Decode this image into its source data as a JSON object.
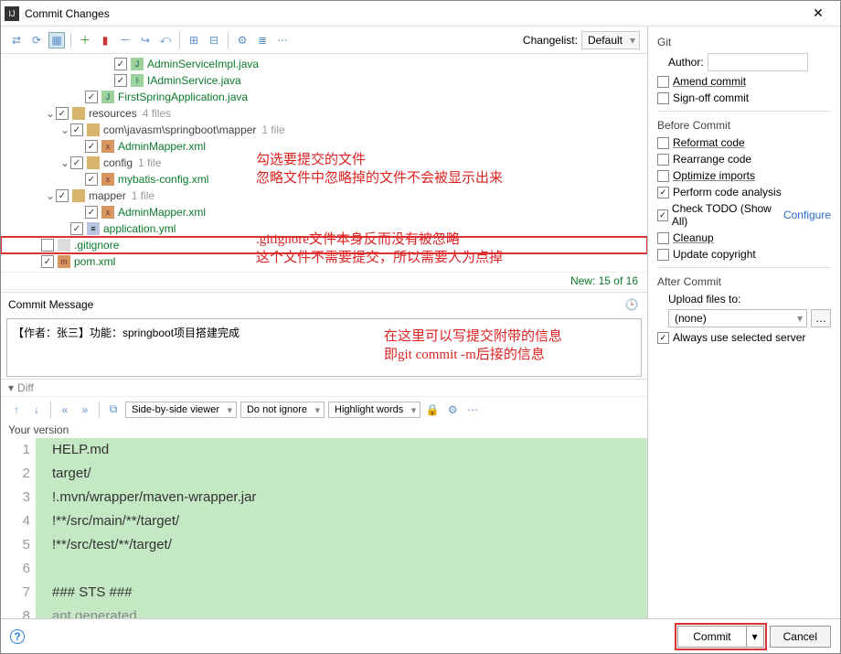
{
  "titlebar": {
    "title": "Commit Changes"
  },
  "toolbar": {
    "changelist_label": "Changelist:",
    "changelist_value": "Default"
  },
  "tree": {
    "rows": [
      {
        "indent": 7,
        "checked": true,
        "arrow": "",
        "iconCls": "javafile",
        "iconTxt": "J",
        "label": "AdminServiceImpl.java",
        "hint": ""
      },
      {
        "indent": 7,
        "checked": true,
        "arrow": "",
        "iconCls": "javafile",
        "iconTxt": "I",
        "label": "IAdminService.java",
        "hint": ""
      },
      {
        "indent": 5,
        "checked": true,
        "arrow": "",
        "iconCls": "javafile",
        "iconTxt": "J",
        "label": "FirstSpringApplication.java",
        "hint": ""
      },
      {
        "indent": 3,
        "checked": true,
        "arrow": "⌄",
        "iconCls": "folder",
        "iconTxt": "",
        "label": "resources",
        "hint": "4 files"
      },
      {
        "indent": 4,
        "checked": true,
        "arrow": "⌄",
        "iconCls": "folder",
        "iconTxt": "",
        "label": "com\\javasm\\springboot\\mapper",
        "hint": "1 file"
      },
      {
        "indent": 5,
        "checked": true,
        "arrow": "",
        "iconCls": "xmlfile",
        "iconTxt": "x",
        "label": "AdminMapper.xml",
        "hint": ""
      },
      {
        "indent": 4,
        "checked": true,
        "arrow": "⌄",
        "iconCls": "folder",
        "iconTxt": "",
        "label": "config",
        "hint": "1 file"
      },
      {
        "indent": 5,
        "checked": true,
        "arrow": "",
        "iconCls": "xmlfile",
        "iconTxt": "x",
        "label": "mybatis-config.xml",
        "hint": ""
      },
      {
        "indent": 3,
        "checked": true,
        "arrow": "⌄",
        "iconCls": "folder",
        "iconTxt": "",
        "label": "mapper",
        "hint": "1 file"
      },
      {
        "indent": 5,
        "checked": true,
        "arrow": "",
        "iconCls": "xmlfile",
        "iconTxt": "x",
        "label": "AdminMapper.xml",
        "hint": ""
      },
      {
        "indent": 4,
        "checked": true,
        "arrow": "",
        "iconCls": "ymlfile",
        "iconTxt": "≡",
        "label": "application.yml",
        "hint": ""
      },
      {
        "indent": 2,
        "checked": false,
        "arrow": "",
        "iconCls": "gitfile",
        "iconTxt": "",
        "label": ".gitignore",
        "hint": "",
        "highlight": true
      },
      {
        "indent": 2,
        "checked": true,
        "arrow": "",
        "iconCls": "xmlfile",
        "iconTxt": "m",
        "label": "pom.xml",
        "hint": ""
      }
    ],
    "status": "New: 15 of 16"
  },
  "commit_message": {
    "header": "Commit Message",
    "value": "【作者：张三】功能：springboot项目搭建完成"
  },
  "diff": {
    "header": "Diff",
    "viewer_mode": "Side-by-side viewer",
    "ignore_mode": "Do not ignore",
    "highlight_mode": "Highlight words",
    "your_version_label": "Your version",
    "lines": [
      "HELP.md",
      "target/",
      "!.mvn/wrapper/maven-wrapper.jar",
      "!**/src/main/**/target/",
      "!**/src/test/**/target/",
      "",
      "### STS ###",
      " ant generated"
    ]
  },
  "side": {
    "git_header": "Git",
    "author_label": "Author:",
    "amend_label": "Amend commit",
    "signoff_label": "Sign-off commit",
    "before_header": "Before Commit",
    "reformat": "Reformat code",
    "rearrange": "Rearrange code",
    "optimize": "Optimize imports",
    "analysis": "Perform code analysis",
    "todo": "Check TODO (Show All)",
    "configure_link": "Configure",
    "cleanup": "Cleanup",
    "copyright": "Update copyright",
    "after_header": "After Commit",
    "upload_label": "Upload files to:",
    "upload_value": "(none)",
    "always_server": "Always use selected server"
  },
  "footer": {
    "commit_label": "Commit",
    "cancel_label": "Cancel"
  },
  "annotations": {
    "a1": "勾选要提交的文件\n忽略文件中忽略掉的文件不会被显示出来",
    "a2": ".gitignore文件本身反而没有被忽略\n这个文件不需要提交，所以需要人为点掉",
    "a3": "在这里可以写提交附带的信息\n即git commit -m后接的信息"
  }
}
